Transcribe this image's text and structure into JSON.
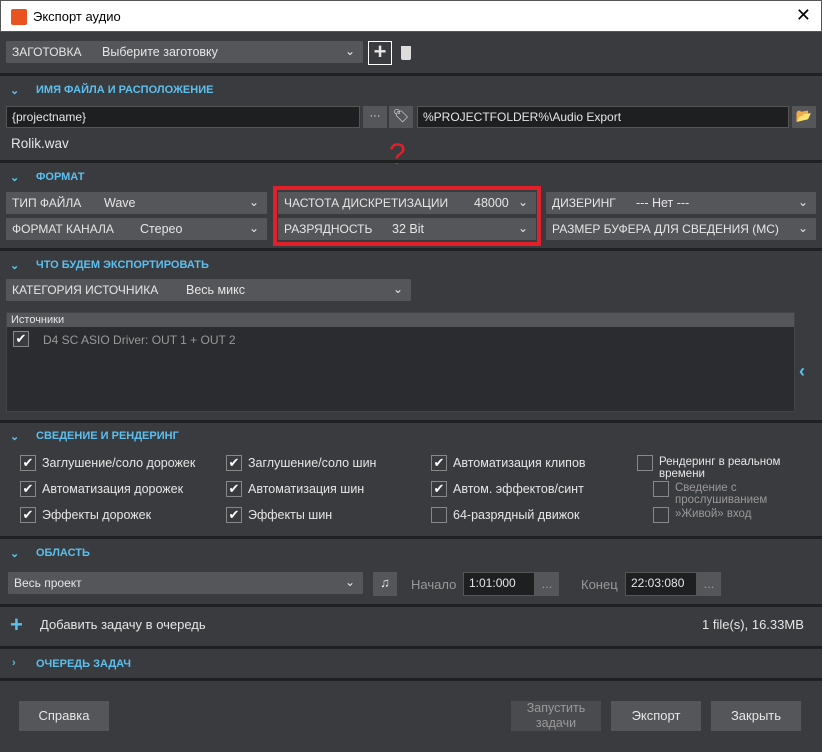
{
  "window": {
    "title": "Экспорт аудио",
    "close": "✕"
  },
  "preset": {
    "label": "ЗАГОТОВКА",
    "value": "Выберите заготовку"
  },
  "file": {
    "section": "ИМЯ ФАЙЛА И РАСПОЛОЖЕНИЕ",
    "name_value": "{projectname}",
    "dots": "···",
    "path_value": "%PROJECTFOLDER%\\Audio Export",
    "result": "Rolik.wav"
  },
  "annotation": {
    "mark": "?",
    "color": "#e0202a"
  },
  "format": {
    "section": "ФОРМАТ",
    "file_type": {
      "label": "ТИП ФАЙЛА",
      "value": "Wave"
    },
    "channel": {
      "label": "ФОРМАТ КАНАЛА",
      "value": "Стерео"
    },
    "sample_rate": {
      "label": "ЧАСТОТА ДИСКРЕТИЗАЦИИ",
      "value": "48000"
    },
    "bit_depth": {
      "label": "РАЗРЯДНОСТЬ",
      "value": "32 Bit"
    },
    "dither": {
      "label": "ДИЗЕРИНГ",
      "value": "--- Нет ---"
    },
    "buffer": {
      "label": "РАЗМЕР БУФЕРА ДЛЯ СВЕДЕНИЯ (МС)",
      "value": ""
    }
  },
  "what": {
    "section": "ЧТО БУДЕМ ЭКСПОРТИРОВАТЬ",
    "category_label": "КАТЕГОРИЯ ИСТОЧНИКА",
    "category_value": "Весь микс",
    "sources_header": "Источники",
    "sources": [
      {
        "label": "D4 SC ASIO Driver: OUT 1 + OUT 2",
        "checked": true
      }
    ]
  },
  "mix": {
    "section": "СВЕДЕНИЕ И РЕНДЕРИНГ",
    "options": [
      {
        "label": "Заглушение/соло дорожек",
        "checked": true
      },
      {
        "label": "Автоматизация дорожек",
        "checked": true
      },
      {
        "label": "Эффекты дорожек",
        "checked": true
      },
      {
        "label": "Заглушение/соло шин",
        "checked": true
      },
      {
        "label": "Автоматизация шин",
        "checked": true
      },
      {
        "label": "Эффекты шин",
        "checked": true
      },
      {
        "label": "Автоматизация клипов",
        "checked": true
      },
      {
        "label": "Автом. эффектов/синт",
        "checked": true
      },
      {
        "label": "64-разрядный движок",
        "checked": false
      },
      {
        "label": "Рендеринг в реальном времени",
        "checked": false
      },
      {
        "label": "Сведение с прослушиванием",
        "checked": false
      },
      {
        "label": "»Живой» вход",
        "checked": false
      }
    ]
  },
  "range": {
    "section": "ОБЛАСТЬ",
    "value": "Весь проект",
    "start_label": "Начало",
    "start": "1:01:000",
    "end_label": "Конец",
    "end": "22:03:080",
    "dots": "..."
  },
  "queue": {
    "add": "Добавить задачу в очередь",
    "summary": "1 file(s), 16.33MB",
    "section": "ОЧЕРЕДЬ ЗАДАЧ"
  },
  "buttons": {
    "help": "Справка",
    "run": "Запустить задачи",
    "export": "Экспорт",
    "close": "Закрыть"
  }
}
